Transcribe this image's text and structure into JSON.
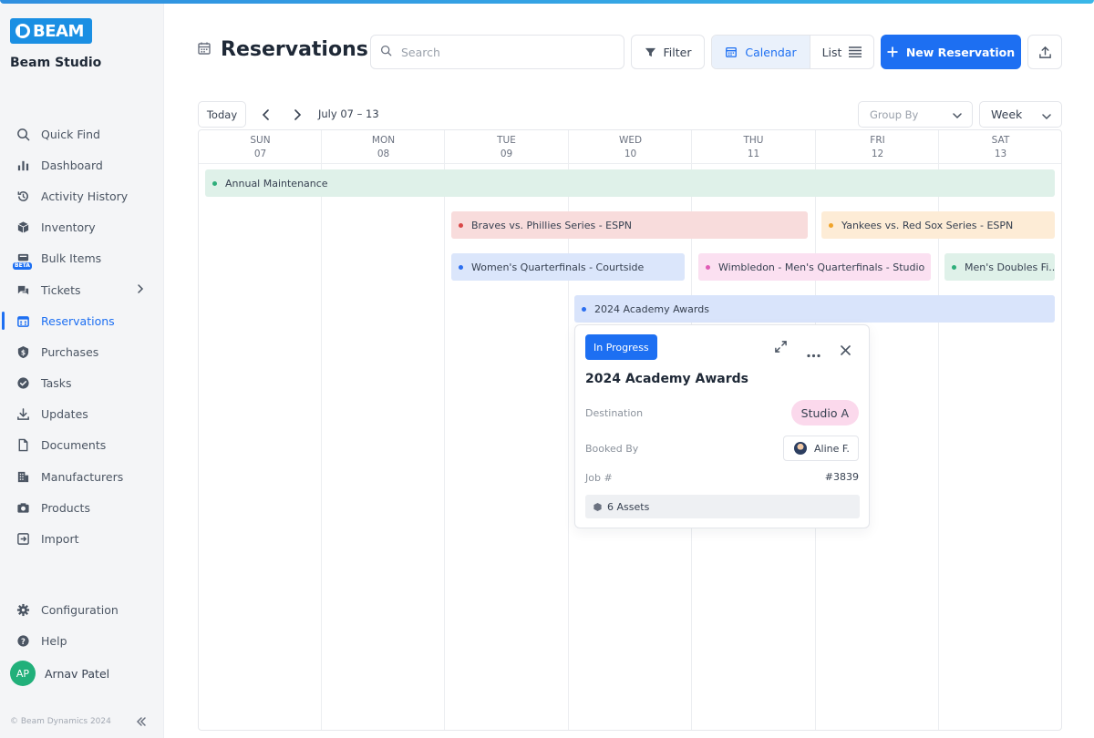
{
  "app": {
    "logo_text": "BEAM",
    "studio_name": "Beam Studio"
  },
  "sidebar": {
    "items": [
      {
        "label": "Quick Find",
        "icon": "search-icon"
      },
      {
        "label": "Dashboard",
        "icon": "bar-chart-icon"
      },
      {
        "label": "Activity History",
        "icon": "history-icon"
      },
      {
        "label": "Inventory",
        "icon": "cube-icon"
      },
      {
        "label": "Bulk Items",
        "icon": "boxes-icon",
        "badge": "BETA"
      },
      {
        "label": "Tickets",
        "icon": "tickets-icon"
      },
      {
        "label": "Reservations",
        "icon": "calendar-icon",
        "active": true
      },
      {
        "label": "Purchases",
        "icon": "dollar-badge-icon"
      },
      {
        "label": "Tasks",
        "icon": "check-circle-icon"
      },
      {
        "label": "Updates",
        "icon": "download-icon"
      },
      {
        "label": "Documents",
        "icon": "document-icon"
      },
      {
        "label": "Manufacturers",
        "icon": "building-icon"
      },
      {
        "label": "Products",
        "icon": "camera-icon"
      },
      {
        "label": "Import",
        "icon": "import-icon"
      }
    ],
    "bottom": [
      {
        "label": "Configuration",
        "icon": "gear-icon"
      },
      {
        "label": "Help",
        "icon": "help-icon"
      }
    ],
    "user": {
      "initials": "AP",
      "name": "Arnav Patel"
    },
    "copyright": "© Beam Dynamics 2024"
  },
  "header": {
    "title": "Reservations",
    "search_placeholder": "Search",
    "filter_label": "Filter",
    "calendar_label": "Calendar",
    "list_label": "List",
    "new_label": "New Reservation"
  },
  "toolbar": {
    "today_label": "Today",
    "range": "July 07 – 13",
    "group_by_placeholder": "Group By",
    "view": "Week"
  },
  "calendar": {
    "days": [
      {
        "dow": "SUN",
        "date": "07"
      },
      {
        "dow": "MON",
        "date": "08"
      },
      {
        "dow": "TUE",
        "date": "09"
      },
      {
        "dow": "WED",
        "date": "10"
      },
      {
        "dow": "THU",
        "date": "11"
      },
      {
        "dow": "FRI",
        "date": "12"
      },
      {
        "dow": "SAT",
        "date": "13"
      }
    ],
    "events": [
      {
        "title": "Annual Maintenance",
        "bg": "#dff1e9",
        "dot": "#2eae7a"
      },
      {
        "title": "Braves vs. Phillies Series - ESPN",
        "bg": "#f8dcdc",
        "dot": "#d94848"
      },
      {
        "title": "Yankees vs. Red Sox Series - ESPN",
        "bg": "#fdecd6",
        "dot": "#f0a42a"
      },
      {
        "title": "Women's Quarterfinals - Courtside",
        "bg": "#dbe6fb",
        "dot": "#2c6ff0"
      },
      {
        "title": "Wimbledon - Men's Quarterfinals - Studio",
        "bg": "#fbe0f1",
        "dot": "#e05cb6"
      },
      {
        "title": "Men's Doubles Fi...",
        "bg": "#dff1e9",
        "dot": "#2eae7a"
      },
      {
        "title": "2024 Academy Awards",
        "bg": "#d9e4fb",
        "dot": "#2c6ff0"
      }
    ]
  },
  "popover": {
    "status": "In Progress",
    "title": "2024 Academy Awards",
    "destination_label": "Destination",
    "destination_value": "Studio A",
    "booked_by_label": "Booked By",
    "booked_by_value": "Aline F.",
    "job_label": "Job #",
    "job_value": "#3839",
    "assets": "6 Assets"
  },
  "colors": {
    "accent": "#1d6ff2",
    "active_nav": "#1d6ff2"
  }
}
